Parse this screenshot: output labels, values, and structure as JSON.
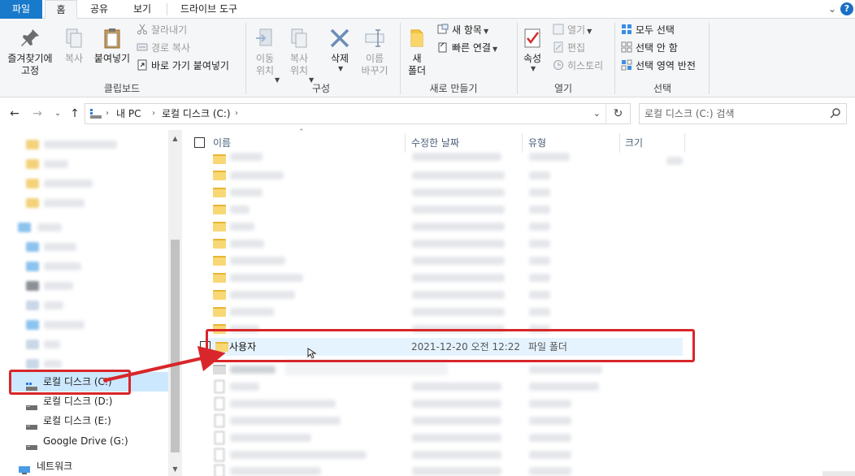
{
  "tabs": [
    {
      "label": "파일"
    },
    {
      "label": "홈"
    },
    {
      "label": "공유"
    },
    {
      "label": "보기"
    },
    {
      "label": "드라이브 도구"
    }
  ],
  "help_label": "?",
  "ribbon": {
    "clipboard": {
      "pin_label": "즐겨찾기에\n고정",
      "copy_label": "복사",
      "paste_label": "붙여넣기",
      "cut_label": "잘라내기",
      "copy_path_label": "경로 복사",
      "paste_shortcut_label": "바로 가기 붙여넣기",
      "group_label": "클립보드"
    },
    "organize": {
      "move_label": "이동\n위치",
      "copyto_label": "복사\n위치",
      "delete_label": "삭제",
      "rename_label": "이름\n바꾸기",
      "group_label": "구성"
    },
    "new": {
      "new_folder_label": "새\n폴더",
      "new_item_label": "새 항목",
      "easy_access_label": "빠른 연결",
      "group_label": "새로 만들기"
    },
    "open": {
      "properties_label": "속성",
      "open_label": "열기",
      "edit_label": "편집",
      "history_label": "히스토리",
      "group_label": "열기"
    },
    "select": {
      "select_all_label": "모두 선택",
      "select_none_label": "선택 안 함",
      "invert_label": "선택 영역 반전",
      "group_label": "선택"
    }
  },
  "address": {
    "crumbs": [
      "내 PC",
      "로컬 디스크 (C:)"
    ]
  },
  "search": {
    "placeholder": "로컬 디스크 (C:) 검색"
  },
  "navpane": {
    "drives": [
      {
        "label": "로컬 디스크 (C:)",
        "selected": true
      },
      {
        "label": "로컬 디스크 (D:)",
        "selected": false
      },
      {
        "label": "로컬 디스크 (E:)",
        "selected": false
      },
      {
        "label": "Google Drive (G:)",
        "selected": false
      }
    ],
    "network_label": "네트워크"
  },
  "columns": [
    "이름",
    "수정한 날짜",
    "유형",
    "크기"
  ],
  "highlighted_row": {
    "name": "사용자",
    "date": "2021-12-20 오전 12:22",
    "type": "파일 폴더"
  },
  "colors": {
    "file_tab": "#1979ca",
    "selection": "#cce8ff",
    "hover_row": "#e5f3ff",
    "annotation_red": "#d8262a",
    "folder": "#f8d775"
  }
}
